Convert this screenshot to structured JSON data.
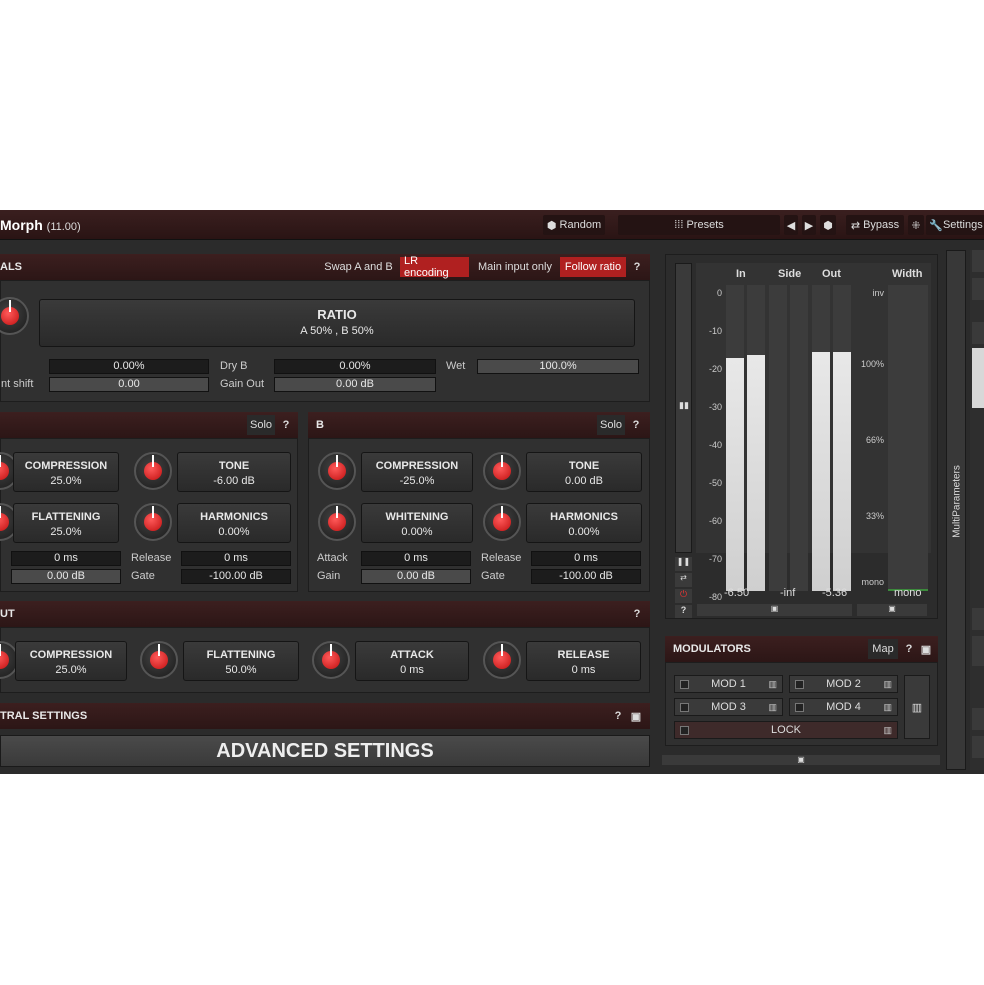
{
  "app": {
    "title": "Morph",
    "version": "(11.00)"
  },
  "topbar": {
    "random": "Random",
    "presets": "Presets",
    "bypass": "Bypass",
    "settings": "Settings"
  },
  "signals": {
    "title": "ALS",
    "swap": "Swap A and B",
    "lr": "LR encoding",
    "main_input": "Main input only",
    "follow": "Follow ratio",
    "help": "?"
  },
  "ratio": {
    "label": "RATIO",
    "value": "A 50% , B 50%"
  },
  "params": {
    "v1": "0.00%",
    "drybl": "Dry B",
    "v2": "0.00%",
    "wetl": "Wet",
    "v3": "100.0%",
    "shiftl": "nt shift",
    "v4": "0.00",
    "gainoutl": "Gain Out",
    "v5": "0.00 dB"
  },
  "panelA": {
    "solo": "Solo",
    "help": "?",
    "c1": {
      "label": "COMPRESSION",
      "value": "25.0%"
    },
    "c2": {
      "label": "TONE",
      "value": "-6.00 dB"
    },
    "c3": {
      "label": "FLATTENING",
      "value": "25.0%"
    },
    "c4": {
      "label": "HARMONICS",
      "value": "0.00%"
    },
    "f1": "0 ms",
    "rel": "Release",
    "f2": "0 ms",
    "f3": "0.00 dB",
    "gate": "Gate",
    "f4": "-100.00 dB"
  },
  "panelB": {
    "title": "B",
    "solo": "Solo",
    "help": "?",
    "c1": {
      "label": "COMPRESSION",
      "value": "-25.0%"
    },
    "c2": {
      "label": "TONE",
      "value": "0.00 dB"
    },
    "c3": {
      "label": "WHITENING",
      "value": "0.00%"
    },
    "c4": {
      "label": "HARMONICS",
      "value": "0.00%"
    },
    "attack": "Attack",
    "f1": "0 ms",
    "rel": "Release",
    "f2": "0 ms",
    "gain": "Gain",
    "f3": "0.00 dB",
    "gate": "Gate",
    "f4": "-100.00 dB"
  },
  "output": {
    "title": "UT",
    "help": "?",
    "c1": {
      "label": "COMPRESSION",
      "value": "25.0%"
    },
    "c2": {
      "label": "FLATTENING",
      "value": "50.0%"
    },
    "c3": {
      "label": "ATTACK",
      "value": "0 ms"
    },
    "c4": {
      "label": "RELEASE",
      "value": "0 ms"
    }
  },
  "spectral": {
    "title": "TRAL SETTINGS",
    "help": "?"
  },
  "advanced": {
    "label": "ADVANCED SETTINGS"
  },
  "meters": {
    "in": "In",
    "side": "Side",
    "out": "Out",
    "width": "Width",
    "ticks": [
      "0",
      "-10",
      "-20",
      "-30",
      "-40",
      "-50",
      "-60",
      "-70",
      "-80"
    ],
    "width_ticks": [
      "inv",
      "100%",
      "66%",
      "33%",
      "mono"
    ],
    "in_val": "-6.50",
    "side_val": "-inf",
    "out_val": "-5.36",
    "width_val": "mono",
    "help": "?",
    "levels": {
      "in_l": 0.76,
      "in_r": 0.77,
      "out_l": 0.78,
      "out_r": 0.78
    }
  },
  "modulators": {
    "title": "MODULATORS",
    "map": "Map",
    "help": "?",
    "mod1": "MOD 1",
    "mod2": "MOD 2",
    "mod3": "MOD 3",
    "mod4": "MOD 4",
    "lock": "LOCK"
  },
  "side": {
    "multiparameters": "MultiParameters"
  }
}
